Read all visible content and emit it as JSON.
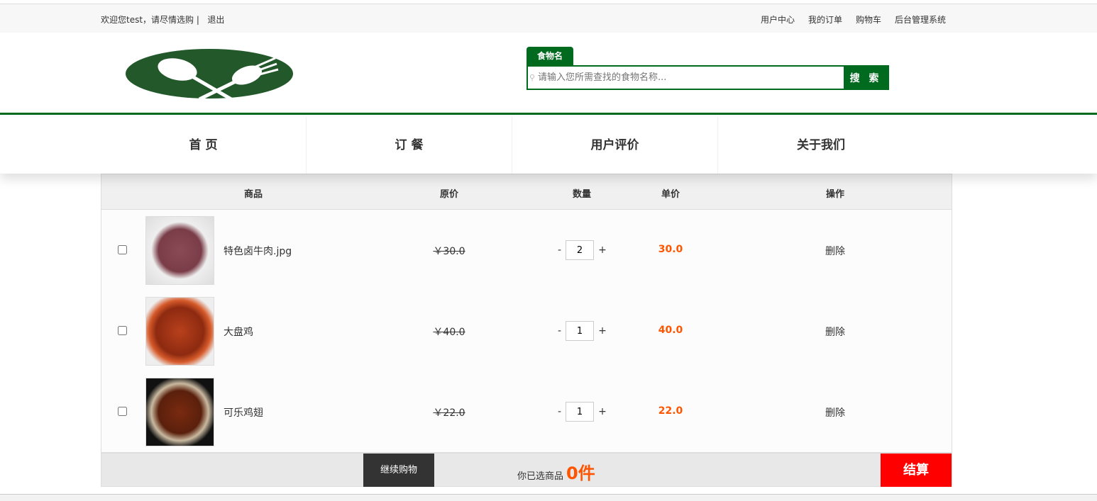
{
  "topbar": {
    "welcome": "欢迎您test，请尽情选购 |",
    "logout": "退出",
    "links": [
      "用户中心",
      "我的订单",
      "购物车",
      "后台管理系统"
    ]
  },
  "search": {
    "tab": "食物名",
    "placeholder": "请输入您所需查找的食物名称...",
    "button": "搜 索"
  },
  "nav": [
    "首 页",
    "订 餐",
    "用户评价",
    "关于我们"
  ],
  "cart": {
    "headers": {
      "product": "商品",
      "original": "原价",
      "quantity": "数量",
      "unit": "单价",
      "action": "操作"
    },
    "rows": [
      {
        "name": "特色卤牛肉.jpg",
        "original": "￥30.0",
        "qty": "2",
        "unit": "30.0",
        "del": "删除"
      },
      {
        "name": "大盘鸡",
        "original": "￥40.0",
        "qty": "1",
        "unit": "40.0",
        "del": "删除"
      },
      {
        "name": "可乐鸡翅",
        "original": "￥22.0",
        "qty": "1",
        "unit": "22.0",
        "del": "删除"
      }
    ],
    "minus": "-",
    "plus": "+",
    "continue": "继续购物",
    "selected_label": "你已选商品",
    "selected_count": "0件",
    "checkout": "结算"
  }
}
